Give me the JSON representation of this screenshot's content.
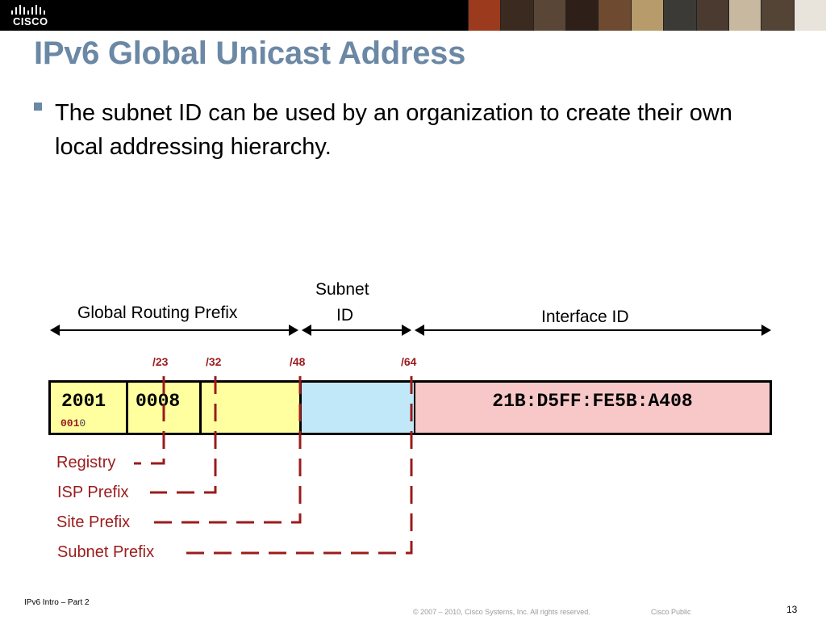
{
  "header": {
    "logo_text": "CISCO",
    "photo_colors": [
      "#9b3a1c",
      "#3b2a20",
      "#5a4636",
      "#2e2018",
      "#6d4a30",
      "#b89b6a",
      "#3c3a36",
      "#4a3a30",
      "#c9b8a0",
      "#544436",
      "#e8e4dc"
    ]
  },
  "slide": {
    "title": "IPv6 Global Unicast Address",
    "bullet": "The subnet ID can be used by an organization to create their own local addressing hierarchy."
  },
  "diagram": {
    "label_global_routing_prefix": "Global Routing Prefix",
    "label_subnet_line1": "Subnet",
    "label_subnet_line2": "ID",
    "label_interface_id": "Interface ID",
    "prefix_marks": [
      "/23",
      "/32",
      "/48",
      "/64"
    ],
    "hextet_1": "2001",
    "hextet_2": "0008",
    "interface_id_value": "21B:D5FF:FE5B:A408",
    "bits_highlight": "001",
    "bits_rest": "0",
    "prefix_labels": [
      "Registry",
      "ISP Prefix",
      "Site Prefix",
      "Subnet Prefix"
    ]
  },
  "colors": {
    "title": "#6b88a5",
    "accent_red": "#9b1b1b",
    "prefix_yellow": "#ffffa0",
    "subnet_blue": "#c0e8f8",
    "interface_pink": "#f8c8c8"
  },
  "footer": {
    "left": "IPv6 Intro – Part 2",
    "copyright": "© 2007 – 2010, Cisco Systems, Inc. All rights reserved.",
    "classification": "Cisco Public",
    "page_number": "13"
  }
}
